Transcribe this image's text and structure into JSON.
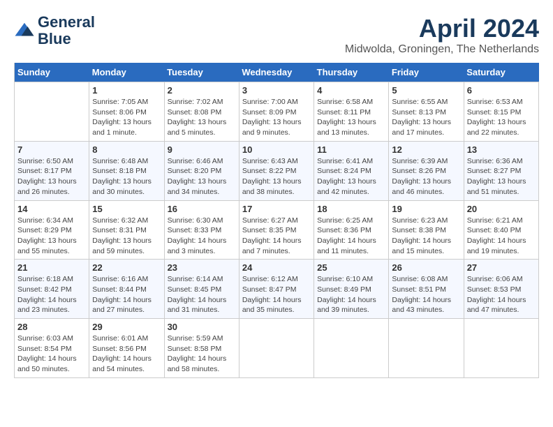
{
  "header": {
    "logo_line1": "General",
    "logo_line2": "Blue",
    "month": "April 2024",
    "location": "Midwolda, Groningen, The Netherlands"
  },
  "days_of_week": [
    "Sunday",
    "Monday",
    "Tuesday",
    "Wednesday",
    "Thursday",
    "Friday",
    "Saturday"
  ],
  "weeks": [
    [
      {
        "day": "",
        "info": ""
      },
      {
        "day": "1",
        "info": "Sunrise: 7:05 AM\nSunset: 8:06 PM\nDaylight: 13 hours\nand 1 minute."
      },
      {
        "day": "2",
        "info": "Sunrise: 7:02 AM\nSunset: 8:08 PM\nDaylight: 13 hours\nand 5 minutes."
      },
      {
        "day": "3",
        "info": "Sunrise: 7:00 AM\nSunset: 8:09 PM\nDaylight: 13 hours\nand 9 minutes."
      },
      {
        "day": "4",
        "info": "Sunrise: 6:58 AM\nSunset: 8:11 PM\nDaylight: 13 hours\nand 13 minutes."
      },
      {
        "day": "5",
        "info": "Sunrise: 6:55 AM\nSunset: 8:13 PM\nDaylight: 13 hours\nand 17 minutes."
      },
      {
        "day": "6",
        "info": "Sunrise: 6:53 AM\nSunset: 8:15 PM\nDaylight: 13 hours\nand 22 minutes."
      }
    ],
    [
      {
        "day": "7",
        "info": "Sunrise: 6:50 AM\nSunset: 8:17 PM\nDaylight: 13 hours\nand 26 minutes."
      },
      {
        "day": "8",
        "info": "Sunrise: 6:48 AM\nSunset: 8:18 PM\nDaylight: 13 hours\nand 30 minutes."
      },
      {
        "day": "9",
        "info": "Sunrise: 6:46 AM\nSunset: 8:20 PM\nDaylight: 13 hours\nand 34 minutes."
      },
      {
        "day": "10",
        "info": "Sunrise: 6:43 AM\nSunset: 8:22 PM\nDaylight: 13 hours\nand 38 minutes."
      },
      {
        "day": "11",
        "info": "Sunrise: 6:41 AM\nSunset: 8:24 PM\nDaylight: 13 hours\nand 42 minutes."
      },
      {
        "day": "12",
        "info": "Sunrise: 6:39 AM\nSunset: 8:26 PM\nDaylight: 13 hours\nand 46 minutes."
      },
      {
        "day": "13",
        "info": "Sunrise: 6:36 AM\nSunset: 8:27 PM\nDaylight: 13 hours\nand 51 minutes."
      }
    ],
    [
      {
        "day": "14",
        "info": "Sunrise: 6:34 AM\nSunset: 8:29 PM\nDaylight: 13 hours\nand 55 minutes."
      },
      {
        "day": "15",
        "info": "Sunrise: 6:32 AM\nSunset: 8:31 PM\nDaylight: 13 hours\nand 59 minutes."
      },
      {
        "day": "16",
        "info": "Sunrise: 6:30 AM\nSunset: 8:33 PM\nDaylight: 14 hours\nand 3 minutes."
      },
      {
        "day": "17",
        "info": "Sunrise: 6:27 AM\nSunset: 8:35 PM\nDaylight: 14 hours\nand 7 minutes."
      },
      {
        "day": "18",
        "info": "Sunrise: 6:25 AM\nSunset: 8:36 PM\nDaylight: 14 hours\nand 11 minutes."
      },
      {
        "day": "19",
        "info": "Sunrise: 6:23 AM\nSunset: 8:38 PM\nDaylight: 14 hours\nand 15 minutes."
      },
      {
        "day": "20",
        "info": "Sunrise: 6:21 AM\nSunset: 8:40 PM\nDaylight: 14 hours\nand 19 minutes."
      }
    ],
    [
      {
        "day": "21",
        "info": "Sunrise: 6:18 AM\nSunset: 8:42 PM\nDaylight: 14 hours\nand 23 minutes."
      },
      {
        "day": "22",
        "info": "Sunrise: 6:16 AM\nSunset: 8:44 PM\nDaylight: 14 hours\nand 27 minutes."
      },
      {
        "day": "23",
        "info": "Sunrise: 6:14 AM\nSunset: 8:45 PM\nDaylight: 14 hours\nand 31 minutes."
      },
      {
        "day": "24",
        "info": "Sunrise: 6:12 AM\nSunset: 8:47 PM\nDaylight: 14 hours\nand 35 minutes."
      },
      {
        "day": "25",
        "info": "Sunrise: 6:10 AM\nSunset: 8:49 PM\nDaylight: 14 hours\nand 39 minutes."
      },
      {
        "day": "26",
        "info": "Sunrise: 6:08 AM\nSunset: 8:51 PM\nDaylight: 14 hours\nand 43 minutes."
      },
      {
        "day": "27",
        "info": "Sunrise: 6:06 AM\nSunset: 8:53 PM\nDaylight: 14 hours\nand 47 minutes."
      }
    ],
    [
      {
        "day": "28",
        "info": "Sunrise: 6:03 AM\nSunset: 8:54 PM\nDaylight: 14 hours\nand 50 minutes."
      },
      {
        "day": "29",
        "info": "Sunrise: 6:01 AM\nSunset: 8:56 PM\nDaylight: 14 hours\nand 54 minutes."
      },
      {
        "day": "30",
        "info": "Sunrise: 5:59 AM\nSunset: 8:58 PM\nDaylight: 14 hours\nand 58 minutes."
      },
      {
        "day": "",
        "info": ""
      },
      {
        "day": "",
        "info": ""
      },
      {
        "day": "",
        "info": ""
      },
      {
        "day": "",
        "info": ""
      }
    ]
  ]
}
